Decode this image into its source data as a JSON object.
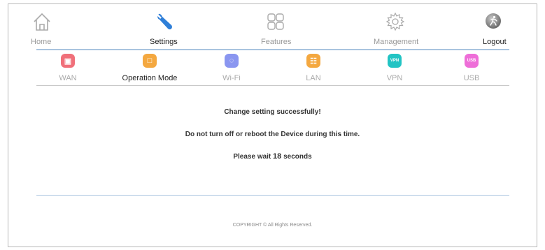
{
  "nav": {
    "home": "Home",
    "settings": "Settings",
    "features": "Features",
    "management": "Management",
    "logout": "Logout"
  },
  "subnav": [
    {
      "label": "WAN",
      "color": "#f0707a",
      "glyph": "▣"
    },
    {
      "label": "Operation Mode",
      "color": "#f4a840",
      "glyph": "□"
    },
    {
      "label": "Wi-Fi",
      "color": "#8a96f0",
      "glyph": "◌"
    },
    {
      "label": "LAN",
      "color": "#f4a840",
      "glyph": "☷"
    },
    {
      "label": "VPN",
      "color": "#22c4c4",
      "glyph": "VPN"
    },
    {
      "label": "USB",
      "color": "#ee6ed8",
      "glyph": "USB"
    }
  ],
  "active_nav": "Settings",
  "active_subnav": "Operation Mode",
  "message": {
    "line1": "Change setting successfully!",
    "line2": "Do not turn off or reboot the Device during this time.",
    "line3_prefix": "Please wait ",
    "countdown": "18",
    "line3_suffix": " seconds"
  },
  "footer": {
    "copyright": "COPYRIGHT © All Rights Reserved."
  },
  "colors": {
    "accent_line": "#a9c4df",
    "settings_icon": "#2f7fd8"
  }
}
